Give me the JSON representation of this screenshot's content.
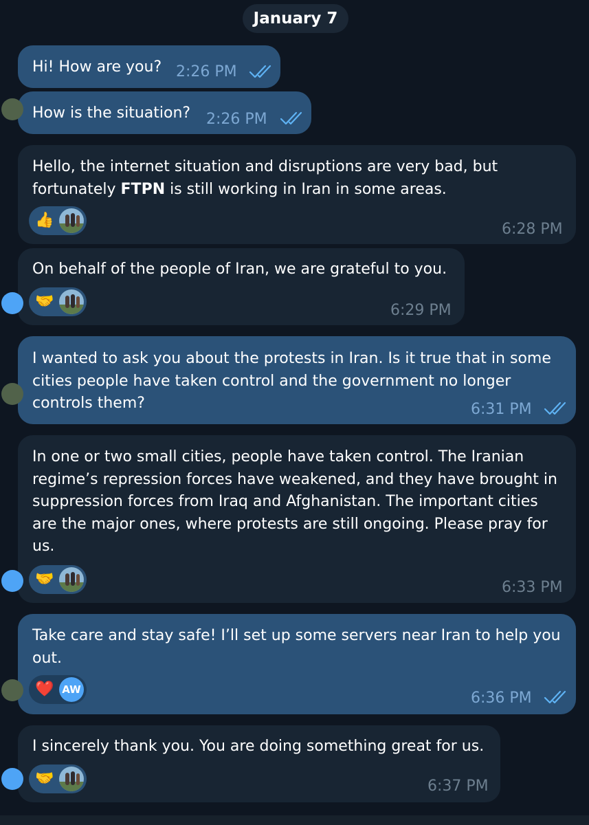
{
  "chat": {
    "date_separator": "January 7",
    "messages": [
      {
        "id": "m1",
        "direction": "outgoing",
        "text": "Hi! How are you?",
        "time": "2:26 PM",
        "status": "read"
      },
      {
        "id": "m2",
        "direction": "outgoing",
        "text": "How is the situation?",
        "time": "2:26 PM",
        "status": "read"
      },
      {
        "id": "m3",
        "direction": "incoming",
        "text_before": "Hello, the internet situation and disruptions are very bad, but fortunately ",
        "text_bold": "FTPN",
        "text_after": " is still working in Iran in some areas.",
        "time": "6:28 PM",
        "reaction": {
          "emoji": "👍",
          "emoji_name": "thumbs-up-icon"
        }
      },
      {
        "id": "m4",
        "direction": "incoming",
        "text": "On behalf of the people of Iran, we are grateful to you.",
        "time": "6:29 PM",
        "reaction": {
          "emoji": "🤝",
          "emoji_name": "handshake-icon"
        }
      },
      {
        "id": "m5",
        "direction": "outgoing",
        "text": "I wanted to ask you about the protests in Iran. Is it true that in some cities people have taken control and the government no longer controls them?",
        "time": "6:31 PM",
        "status": "read"
      },
      {
        "id": "m6",
        "direction": "incoming",
        "text": "In one or two small cities, people have taken control. The Iranian regime’s repression forces have weakened, and they have brought in suppression forces from Iraq and Afghanistan. The important cities are the major ones, where protests are still ongoing. Please pray for us.",
        "time": "6:33 PM",
        "reaction": {
          "emoji": "🤝",
          "emoji_name": "handshake-icon"
        }
      },
      {
        "id": "m7",
        "direction": "outgoing",
        "text": "Take care and stay safe! I’ll set up some servers near Iran to help you out.",
        "time": "6:36 PM",
        "status": "read",
        "reaction": {
          "emoji": "❤️",
          "emoji_name": "heart-icon",
          "avatar_initials": "AW"
        }
      },
      {
        "id": "m8",
        "direction": "incoming",
        "text": "I sincerely thank you. You are doing something great for us.",
        "time": "6:37 PM",
        "reaction": {
          "emoji": "🤝",
          "emoji_name": "handshake-icon"
        }
      }
    ]
  },
  "colors": {
    "background": "#0e1621",
    "outgoing_bubble": "#2b5278",
    "incoming_bubble": "#182533",
    "outgoing_meta": "#7da8d3",
    "incoming_meta": "#6d7f8f",
    "read_check": "#5fb3f4",
    "reaction_badge": "#2b5278",
    "initials_avatar": "#4ea4f6"
  }
}
